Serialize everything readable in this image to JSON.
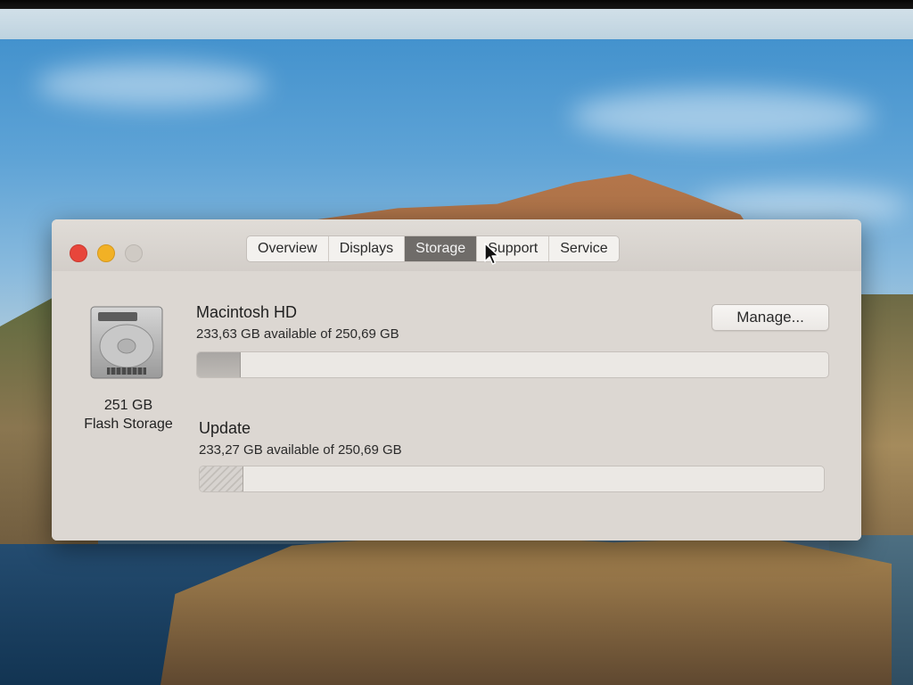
{
  "window": {
    "tabs": [
      {
        "label": "Overview"
      },
      {
        "label": "Displays"
      },
      {
        "label": "Storage"
      },
      {
        "label": "Support"
      },
      {
        "label": "Service"
      }
    ],
    "active_tab": "Storage"
  },
  "disk": {
    "icon": "hard-drive-icon",
    "capacity": "251 GB",
    "type": "Flash Storage"
  },
  "volumes": [
    {
      "name": "Macintosh HD",
      "available": "233,63 GB available of 250,69 GB",
      "used_fraction": 0.068,
      "fill_style": "solid"
    },
    {
      "name": "Update",
      "available": "233,27 GB available of 250,69 GB",
      "used_fraction": 0.069,
      "fill_style": "hatched"
    }
  ],
  "manage_button": {
    "label": "Manage..."
  },
  "colors": {
    "close": "#e8463b",
    "minimize": "#f2b125",
    "active_tab": "#6f6c69"
  }
}
